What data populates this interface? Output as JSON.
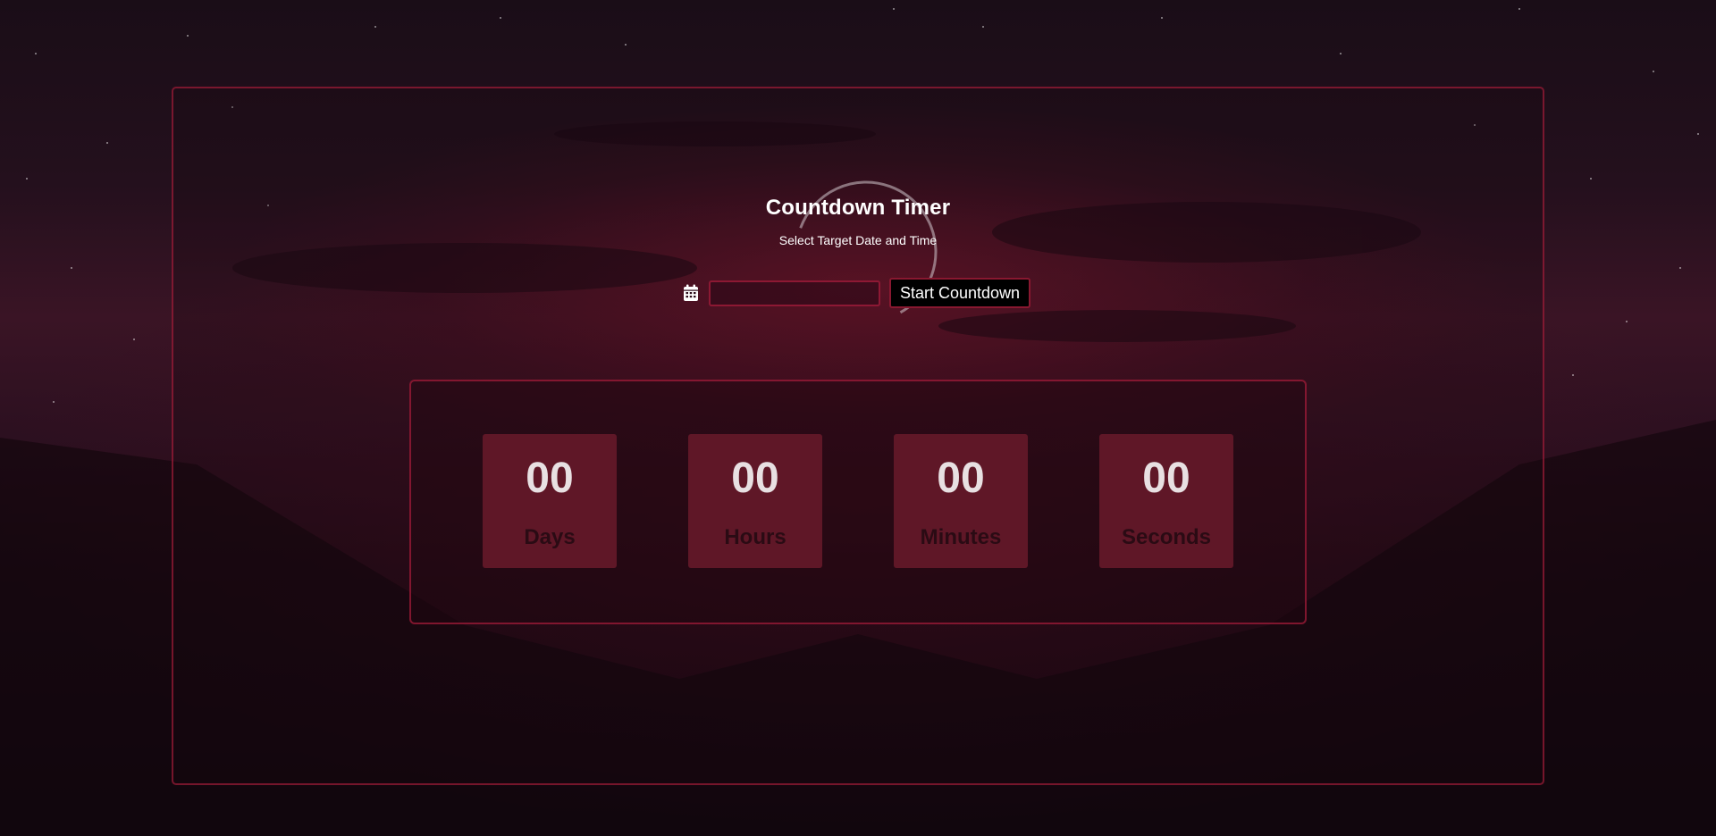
{
  "app": {
    "title": "Countdown Timer",
    "subtitle": "Select Target Date and Time"
  },
  "controls": {
    "date_icon": "calendar-icon",
    "date_value": "",
    "start_label": "Start Countdown"
  },
  "timer": {
    "units": [
      {
        "value": "00",
        "label": "Days"
      },
      {
        "value": "00",
        "label": "Hours"
      },
      {
        "value": "00",
        "label": "Minutes"
      },
      {
        "value": "00",
        "label": "Seconds"
      }
    ]
  },
  "colors": {
    "accent_border": "#aa1e3c",
    "unit_tile": "#5f1727",
    "button_bg": "#000000",
    "text_primary": "#ffffff"
  }
}
